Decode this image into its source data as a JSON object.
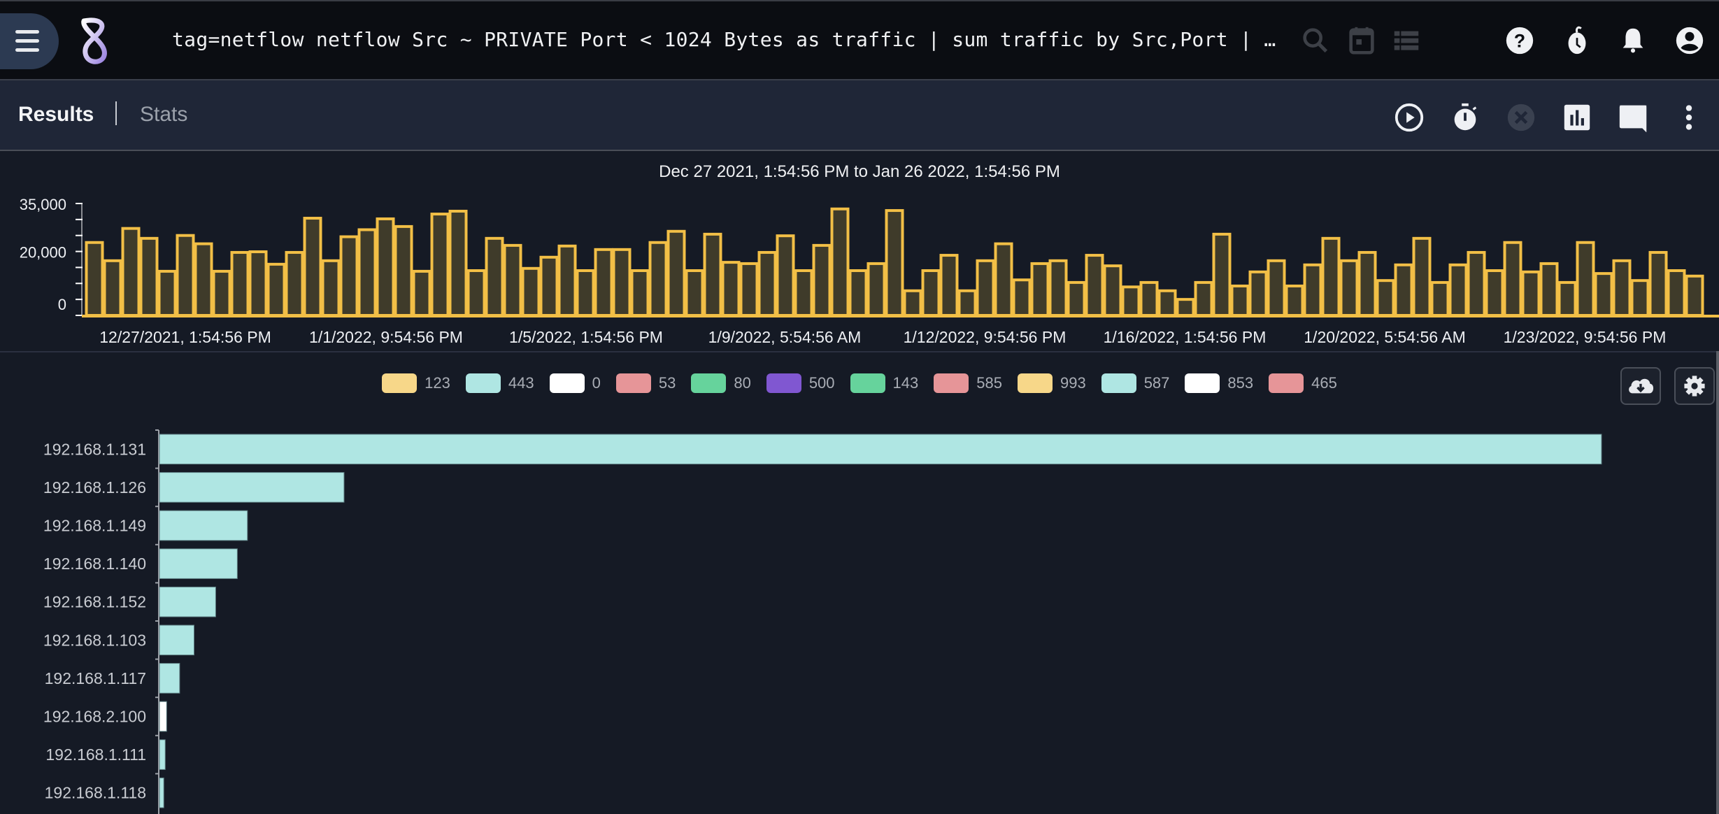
{
  "topbar": {
    "query": "tag=netflow netflow Src ~ PRIVATE Port < 1024 Bytes as traffic | sum traffic by Src,Port | …",
    "icons": [
      "menu-icon",
      "gravwell-logo",
      "search-icon",
      "calendar-icon",
      "list-icon",
      "help-icon",
      "timer-icon",
      "bell-icon",
      "account-icon"
    ]
  },
  "subbar": {
    "tabs": [
      {
        "label": "Results",
        "active": true
      },
      {
        "label": "Stats",
        "active": false
      }
    ],
    "actions": [
      "play-icon",
      "stopwatch-icon",
      "cancel-icon",
      "chart-icon",
      "comment-icon",
      "more-icon"
    ]
  },
  "overview": {
    "range_title": "Dec 27 2021, 1:54:56 PM to Jan 26 2022, 1:54:56 PM"
  },
  "legend_colors": {
    "yellow": "#f7d789",
    "cyan": "#afe6e3",
    "white": "#ffffff",
    "pink": "#e69598",
    "green": "#66d39c",
    "purple": "#8057d1"
  },
  "chart_data": [
    {
      "type": "bar",
      "title": "Dec 27 2021, 1:54:56 PM to Jan 26 2022, 1:54:56 PM",
      "xlabel": "",
      "ylabel": "",
      "ylim": [
        0,
        35000
      ],
      "y_ticks": [
        "35,000",
        "20,000",
        "0"
      ],
      "y_tick_values": [
        35000,
        20000,
        0
      ],
      "x_tick_labels": [
        "12/27/2021, 1:54:56 PM",
        "1/1/2022, 9:54:56 PM",
        "1/5/2022, 1:54:56 PM",
        "1/9/2022, 5:54:56 AM",
        "1/12/2022, 9:54:56 PM",
        "1/16/2022, 1:54:56 PM",
        "1/20/2022, 5:54:56 AM",
        "1/23/2022, 9:54:56 PM"
      ],
      "bar_color": "#f2bf46",
      "bar_fill": "#3f3b2a",
      "values": [
        22800,
        17100,
        27200,
        24100,
        13800,
        25000,
        22400,
        13800,
        19700,
        19900,
        16000,
        19700,
        30400,
        17100,
        24600,
        26800,
        30200,
        27800,
        13800,
        31700,
        32600,
        14000,
        24100,
        21900,
        14700,
        18200,
        21700,
        14000,
        20600,
        20600,
        14000,
        22800,
        26300,
        14000,
        25400,
        16600,
        16200,
        19700,
        24900,
        14000,
        21900,
        33300,
        14000,
        16200,
        32800,
        7700,
        14000,
        18800,
        7700,
        17100,
        22400,
        11100,
        16200,
        17100,
        10300,
        18800,
        15500,
        8900,
        10300,
        7700,
        5000,
        10300,
        25400,
        9200,
        13600,
        17100,
        9200,
        15800,
        24100,
        17100,
        19700,
        10900,
        15800,
        24100,
        10300,
        15800,
        19700,
        14000,
        22800,
        13600,
        16200,
        10300,
        22800,
        13100,
        17100,
        10900,
        19700,
        14000,
        12300
      ]
    },
    {
      "type": "bar",
      "orientation": "horizontal",
      "title": "",
      "xlabel": "",
      "ylabel": "",
      "categories": [
        "192.168.1.131",
        "192.168.1.126",
        "192.168.1.149",
        "192.168.1.140",
        "192.168.1.152",
        "192.168.1.103",
        "192.168.1.117",
        "192.168.2.100",
        "192.168.1.111",
        "192.168.1.118"
      ],
      "values": [
        100,
        12.8,
        6.1,
        5.4,
        3.9,
        2.4,
        1.4,
        0.5,
        0.4,
        0.3
      ],
      "value_units": "percent of largest bar",
      "bar_series": [
        "443",
        "443",
        "443",
        "443",
        "443",
        "443",
        "443",
        "0",
        "443",
        "443"
      ],
      "legend_position": "top-center",
      "legend": [
        {
          "label": "123",
          "color": "#f7d789"
        },
        {
          "label": "443",
          "color": "#afe6e3"
        },
        {
          "label": "0",
          "color": "#ffffff"
        },
        {
          "label": "53",
          "color": "#e69598"
        },
        {
          "label": "80",
          "color": "#66d39c"
        },
        {
          "label": "500",
          "color": "#8057d1"
        },
        {
          "label": "143",
          "color": "#66d39c"
        },
        {
          "label": "585",
          "color": "#e69598"
        },
        {
          "label": "993",
          "color": "#f7d789"
        },
        {
          "label": "587",
          "color": "#afe6e3"
        },
        {
          "label": "853",
          "color": "#ffffff"
        },
        {
          "label": "465",
          "color": "#e69598"
        }
      ]
    }
  ],
  "chart_tools": [
    "download-icon",
    "settings-icon"
  ]
}
